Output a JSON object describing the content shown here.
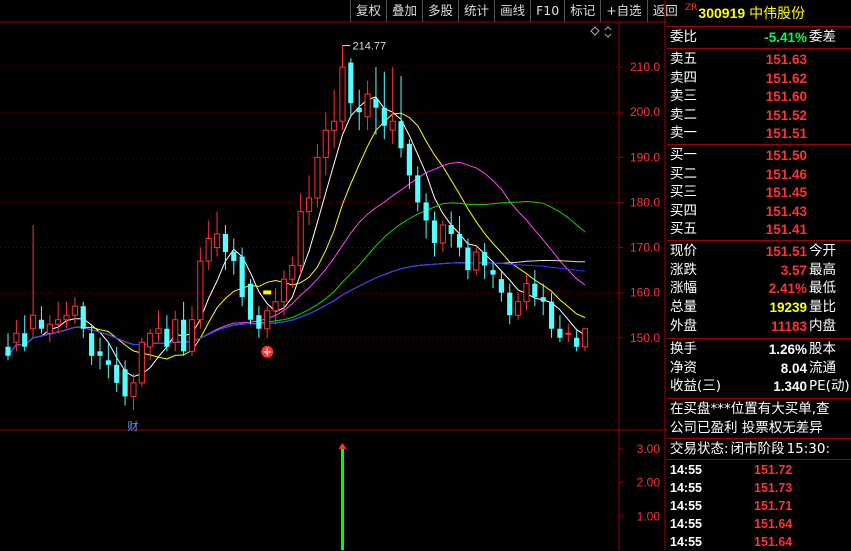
{
  "toolbar": [
    "复权",
    "叠加",
    "多股",
    "统计",
    "画线",
    "F10",
    "标记",
    "+自选",
    "返回"
  ],
  "stock": {
    "tag": "ZR",
    "code": "300919",
    "name": "中伟股份"
  },
  "colors": {
    "up": "#ff3232",
    "down": "#54ffff",
    "flat": "#ffffff",
    "yellow": "#ffff00",
    "bg": "#000000",
    "grid": "#a00000"
  },
  "quote": {
    "weibi": {
      "label": "委比",
      "value": "-5.41%",
      "right": "委差"
    },
    "asks": [
      {
        "label": "卖五",
        "price": "151.63"
      },
      {
        "label": "卖四",
        "price": "151.62"
      },
      {
        "label": "卖三",
        "price": "151.60"
      },
      {
        "label": "卖二",
        "price": "151.52"
      },
      {
        "label": "卖一",
        "price": "151.51"
      }
    ],
    "bids": [
      {
        "label": "买一",
        "price": "151.50"
      },
      {
        "label": "买二",
        "price": "151.46"
      },
      {
        "label": "买三",
        "price": "151.45"
      },
      {
        "label": "买四",
        "price": "151.43"
      },
      {
        "label": "买五",
        "price": "151.41"
      }
    ],
    "stats1": [
      {
        "label": "现价",
        "value": "151.51",
        "right": "今开",
        "color": "up"
      },
      {
        "label": "涨跌",
        "value": "3.57",
        "right": "最高",
        "color": "up"
      },
      {
        "label": "涨幅",
        "value": "2.41%",
        "right": "最低",
        "color": "up"
      },
      {
        "label": "总量",
        "value": "19239",
        "right": "量比",
        "color": "yellow"
      },
      {
        "label": "外盘",
        "value": "11183",
        "right": "内盘",
        "color": "up"
      }
    ],
    "stats2": [
      {
        "label": "换手",
        "value": "1.26%",
        "right": "股本",
        "color": "flat"
      },
      {
        "label": "净资",
        "value": "8.04",
        "right": "流通",
        "color": "flat"
      },
      {
        "label": "收益(三)",
        "value": "1.340",
        "right": "PE(动)",
        "color": "flat"
      }
    ],
    "news1": "在买盘***位置有大买单,查",
    "news2": "公司已盈利 投票权无差异",
    "status_label": "交易状态:",
    "status_value": "闭市阶段",
    "status_time": "15:30:",
    "ticks": [
      {
        "time": "14:55",
        "price": "151.72"
      },
      {
        "time": "14:55",
        "price": "151.73"
      },
      {
        "time": "14:55",
        "price": "151.71"
      },
      {
        "time": "14:55",
        "price": "151.64"
      },
      {
        "time": "14:55",
        "price": "151.64"
      }
    ]
  },
  "chart_data": {
    "type": "candlestick",
    "ylim": [
      130,
      220
    ],
    "yticks": [
      150,
      160,
      170,
      180,
      190,
      200,
      210
    ],
    "max_label": "214.77",
    "annotation": "财",
    "indicator_ylim": [
      0,
      3.5
    ],
    "indicator_ticks": [
      "3.00",
      "2.00",
      "1.00"
    ],
    "indicator_signal": {
      "index": 40,
      "value": 3.0
    },
    "candles": [
      {
        "o": 148,
        "h": 151,
        "c": 146,
        "l": 145
      },
      {
        "o": 149,
        "h": 154,
        "c": 151,
        "l": 147
      },
      {
        "o": 151,
        "h": 155,
        "c": 148,
        "l": 147
      },
      {
        "o": 152,
        "h": 175,
        "c": 155,
        "l": 150
      },
      {
        "o": 154,
        "h": 157,
        "c": 152,
        "l": 151
      },
      {
        "o": 151,
        "h": 155,
        "c": 153,
        "l": 149
      },
      {
        "o": 153,
        "h": 158,
        "c": 154,
        "l": 151
      },
      {
        "o": 154,
        "h": 158,
        "c": 155,
        "l": 152
      },
      {
        "o": 155,
        "h": 159,
        "c": 157,
        "l": 153
      },
      {
        "o": 157,
        "h": 158,
        "c": 152,
        "l": 150
      },
      {
        "o": 151,
        "h": 153,
        "c": 146,
        "l": 144
      },
      {
        "o": 147,
        "h": 150,
        "c": 146,
        "l": 143
      },
      {
        "o": 145,
        "h": 149,
        "c": 144,
        "l": 141
      },
      {
        "o": 144,
        "h": 148,
        "c": 140,
        "l": 138
      },
      {
        "o": 143,
        "h": 145,
        "c": 137,
        "l": 135
      },
      {
        "o": 137,
        "h": 142,
        "c": 140,
        "l": 134
      },
      {
        "o": 140,
        "h": 150,
        "c": 149,
        "l": 139
      },
      {
        "o": 148,
        "h": 152,
        "c": 151,
        "l": 145
      },
      {
        "o": 151,
        "h": 156,
        "c": 152,
        "l": 149
      },
      {
        "o": 152,
        "h": 155,
        "c": 148,
        "l": 147
      },
      {
        "o": 149,
        "h": 156,
        "c": 154,
        "l": 147
      },
      {
        "o": 154,
        "h": 158,
        "c": 147,
        "l": 146
      },
      {
        "o": 147,
        "h": 157,
        "c": 154,
        "l": 146
      },
      {
        "o": 154,
        "h": 170,
        "c": 167,
        "l": 152
      },
      {
        "o": 167,
        "h": 176,
        "c": 172,
        "l": 165
      },
      {
        "o": 170,
        "h": 178,
        "c": 173,
        "l": 168
      },
      {
        "o": 173,
        "h": 175,
        "c": 169,
        "l": 165
      },
      {
        "o": 169,
        "h": 172,
        "c": 167,
        "l": 164
      },
      {
        "o": 168,
        "h": 170,
        "c": 159,
        "l": 157
      },
      {
        "o": 162,
        "h": 163,
        "c": 154,
        "l": 153
      },
      {
        "o": 155,
        "h": 157,
        "c": 152,
        "l": 150
      },
      {
        "o": 152,
        "h": 157,
        "c": 156,
        "l": 150
      },
      {
        "o": 156,
        "h": 161,
        "c": 158,
        "l": 153
      },
      {
        "o": 158,
        "h": 165,
        "c": 163,
        "l": 155
      },
      {
        "o": 163,
        "h": 168,
        "c": 166,
        "l": 161
      },
      {
        "o": 166,
        "h": 182,
        "c": 178,
        "l": 164
      },
      {
        "o": 178,
        "h": 186,
        "c": 181,
        "l": 175
      },
      {
        "o": 181,
        "h": 193,
        "c": 190,
        "l": 179
      },
      {
        "o": 190,
        "h": 200,
        "c": 196,
        "l": 186
      },
      {
        "o": 196,
        "h": 205,
        "c": 198,
        "l": 192
      },
      {
        "o": 198,
        "h": 214.77,
        "c": 210,
        "l": 196
      },
      {
        "o": 211,
        "h": 212,
        "c": 202,
        "l": 199
      },
      {
        "o": 201,
        "h": 205,
        "c": 200,
        "l": 196
      },
      {
        "o": 199,
        "h": 207,
        "c": 204,
        "l": 196
      },
      {
        "o": 203,
        "h": 210,
        "c": 201,
        "l": 195
      },
      {
        "o": 201,
        "h": 209,
        "c": 197,
        "l": 194
      },
      {
        "o": 196,
        "h": 210,
        "c": 198,
        "l": 193
      },
      {
        "o": 198,
        "h": 208,
        "c": 192,
        "l": 190
      },
      {
        "o": 193,
        "h": 194,
        "c": 186,
        "l": 183
      },
      {
        "o": 186,
        "h": 188,
        "c": 180,
        "l": 178
      },
      {
        "o": 180,
        "h": 182,
        "c": 176,
        "l": 172
      },
      {
        "o": 176,
        "h": 178,
        "c": 171,
        "l": 168
      },
      {
        "o": 171,
        "h": 176,
        "c": 175,
        "l": 169
      },
      {
        "o": 175,
        "h": 178,
        "c": 173,
        "l": 170
      },
      {
        "o": 173,
        "h": 177,
        "c": 170,
        "l": 168
      },
      {
        "o": 170,
        "h": 172,
        "c": 165,
        "l": 163
      },
      {
        "o": 165,
        "h": 170,
        "c": 169,
        "l": 164
      },
      {
        "o": 169,
        "h": 171,
        "c": 166,
        "l": 163
      },
      {
        "o": 165,
        "h": 167,
        "c": 164,
        "l": 161
      },
      {
        "o": 163,
        "h": 165,
        "c": 160,
        "l": 158
      },
      {
        "o": 160,
        "h": 162,
        "c": 155,
        "l": 153
      },
      {
        "o": 155,
        "h": 160,
        "c": 158,
        "l": 154
      },
      {
        "o": 158,
        "h": 164,
        "c": 162,
        "l": 156
      },
      {
        "o": 162,
        "h": 165,
        "c": 159,
        "l": 157
      },
      {
        "o": 159,
        "h": 162,
        "c": 158,
        "l": 155
      },
      {
        "o": 158,
        "h": 160,
        "c": 152,
        "l": 150
      },
      {
        "o": 152,
        "h": 155,
        "c": 150,
        "l": 149
      },
      {
        "o": 151,
        "h": 153,
        "c": 151,
        "l": 149
      },
      {
        "o": 150,
        "h": 152,
        "c": 148,
        "l": 147
      },
      {
        "o": 148,
        "h": 152,
        "c": 152,
        "l": 147
      }
    ]
  }
}
